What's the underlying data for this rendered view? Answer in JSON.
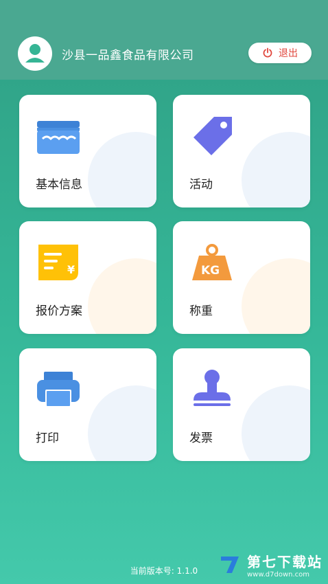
{
  "header": {
    "company_name": "沙县一品鑫食品有限公司",
    "logout_label": "退出",
    "avatar_icon": "user-icon",
    "logout_icon": "power-icon"
  },
  "menu": [
    {
      "label": "基本信息",
      "icon": "store-icon"
    },
    {
      "label": "活动",
      "icon": "tag-icon"
    },
    {
      "label": "报价方案",
      "icon": "quote-icon"
    },
    {
      "label": "称重",
      "icon": "weight-icon"
    },
    {
      "label": "打印",
      "icon": "printer-icon"
    },
    {
      "label": "发票",
      "icon": "stamp-icon"
    }
  ],
  "footer": {
    "version_text": "当前版本号: 1.1.0"
  },
  "watermark": {
    "title": "第七下载站",
    "url": "www.d7down.com"
  },
  "colors": {
    "accent_green": "#36b595",
    "logout_red": "#e0463c",
    "blue": "#4a90e2",
    "purple": "#6b6fe8",
    "yellow": "#ffc107",
    "orange": "#f39a3d"
  }
}
